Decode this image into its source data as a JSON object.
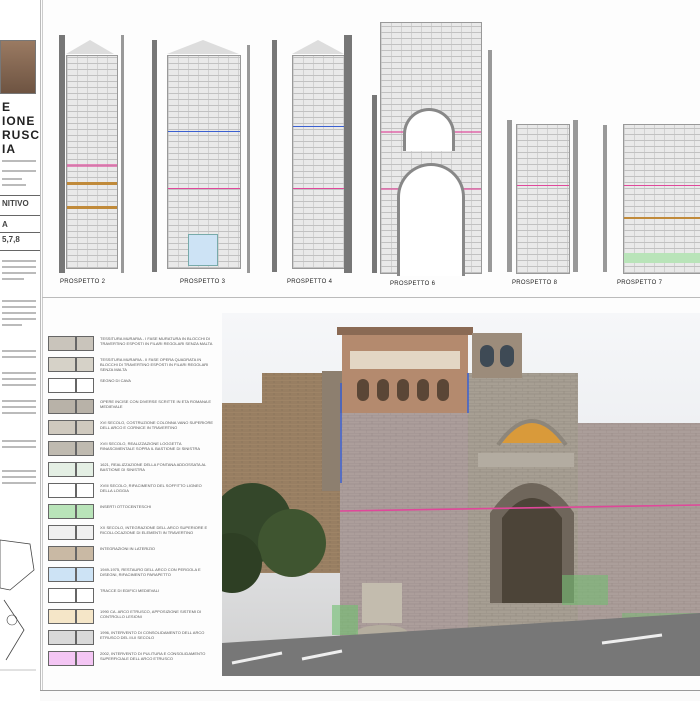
{
  "title_block": {
    "title_line1": "E",
    "title_line2": "IONE",
    "title_line3": "RUSCO",
    "title_line4": "IA",
    "status": "NITIVO",
    "sheet_code_a": "A",
    "sheet_code_b": "5,7,8"
  },
  "elevations": [
    {
      "label": "PROSPETTO 2"
    },
    {
      "label": "PROSPETTO 3"
    },
    {
      "label": "PROSPETTO 4"
    },
    {
      "label": "PROSPETTO 6"
    },
    {
      "label": "PROSPETTO 8"
    },
    {
      "label": "PROSPETTO 7"
    }
  ],
  "legend": [
    {
      "text": "TESSITURA MURARIA - I FASE MURATURA IN BLOCCHI DI TRAVERTINO ESPOSTI IN FILARI REGOLARI SENZA MALTA",
      "color": "#c9c4bb"
    },
    {
      "text": "TESSITURA MURARIA - II FASE OPERA QUADRATA IN BLOCCHI DI TRAVERTINO ESPOSTI IN FILARI REGOLARI SENZA MALTA",
      "color": "#d6d2c8"
    },
    {
      "text": "SEGNO DI CAVA",
      "color": "#ffffff"
    },
    {
      "text": "OPERE INCISE CON DIVERSE SCRITTE IN ETA ROMANA E MEDIEVALE",
      "color": "#b8b2a8"
    },
    {
      "text": "XVI SECOLO, COSTRUZIONE COLONNA VANO SUPERIORE DELL ARCO E CORNICE IN TRAVERTINO",
      "color": "#cfc9be"
    },
    {
      "text": "XVII SECOLO, REALIZZAZIONE LOGGETTA RINASCIMENTALE SOPRA IL BASTIONE DI SINISTRA",
      "color": "#bfbab0"
    },
    {
      "text": "1621, REALIZZAZIONE DELLA FONTANA ADDOSSATA AL BASTIONE DI SINISTRA",
      "color": "#e4efe4"
    },
    {
      "text": "XVIII SECOLO, RIFACIMENTO DEL SOFFITTO LIGNEO DELLA LOGGIA",
      "color": "#ffffff"
    },
    {
      "text": "INSERTI OTTOCENTESCHI",
      "color": "#b9e4b9"
    },
    {
      "text": "XX SECOLO, INTEGRAZIONE DELL ARCO SUPERIORE E RICOLLOCAZIONE DI ELEMENTI IN TRAVERTINO",
      "color": "#f0f0f0"
    },
    {
      "text": "INTEGRAZIONI IN LATERIZIO",
      "color": "#c9b9a4"
    },
    {
      "text": "1949-1975, RESTAURO DELL ARCO CON PERGOLA E DISEGNI, RIFACIMENTO PARAPETTO",
      "color": "#cde3f5"
    },
    {
      "text": "TRACCE DI EDIFICI MEDIEVALI",
      "color": "#ffffff"
    },
    {
      "text": "1990 CA. ARCO ETRUSCO, APPOSIZIONE SISTEMI DI CONTROLLO LESIONI",
      "color": "#f5e6c8"
    },
    {
      "text": "1996, INTERVENTO DI CONSOLIDAMENTO DELL ARCO ETRUSCO DEL III-II SECOLO",
      "color": "#d9d9d9"
    },
    {
      "text": "2002, INTERVENTO DI PULITURA E CONSOLIDAMENTO SUPERFICIALE DELL ARCO ETRUSCO",
      "color": "#f4c6f4"
    }
  ],
  "colors": {
    "magenta_line": "#e0479a",
    "blue_line": "#3a5fd0",
    "frame_gray": "#777777",
    "stone": "#bdb6aa"
  },
  "icons": [
    "north-arrow-icon"
  ]
}
